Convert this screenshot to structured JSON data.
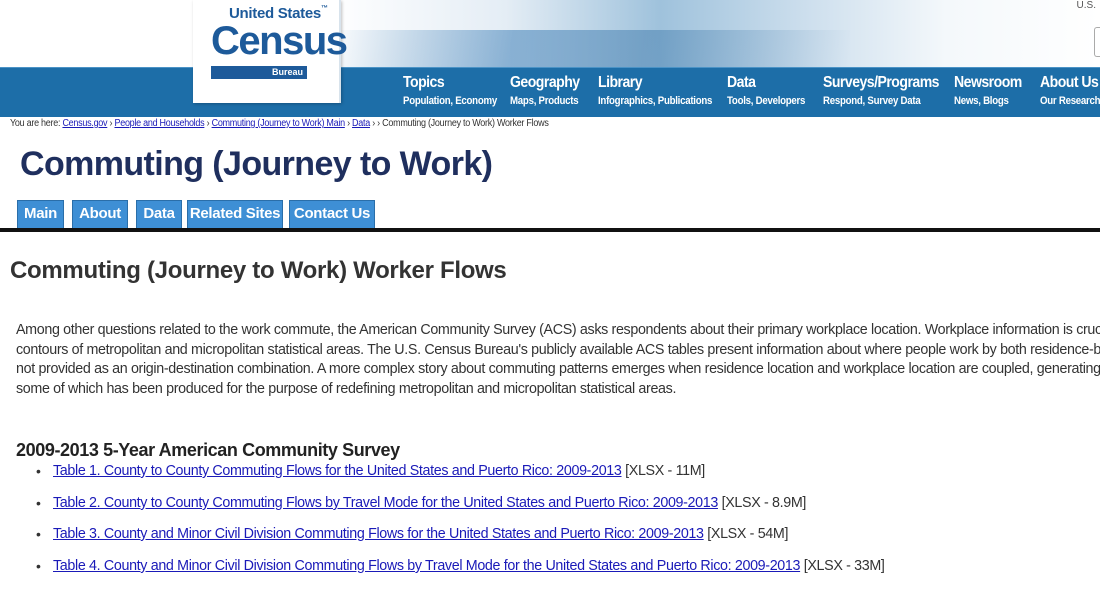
{
  "header": {
    "logo": {
      "line1": "United States",
      "tm": "™",
      "line2": "Census",
      "line3": "Bureau"
    },
    "corner_text": "U.S.",
    "nav": [
      {
        "title": "Topics",
        "sub": "Population, Economy"
      },
      {
        "title": "Geography",
        "sub": "Maps, Products"
      },
      {
        "title": "Library",
        "sub": "Infographics, Publications"
      },
      {
        "title": "Data",
        "sub": "Tools, Developers"
      },
      {
        "title": "Surveys/Programs",
        "sub": "Respond, Survey Data"
      },
      {
        "title": "Newsroom",
        "sub": "News, Blogs"
      },
      {
        "title": "About Us",
        "sub": "Our Research"
      }
    ],
    "colors": {
      "nav_bar": "#1d6ea8",
      "logo_blue": "#1d5a9a"
    }
  },
  "breadcrumb": {
    "prefix": "You are here:",
    "links": [
      "Census.gov",
      "People and Households",
      "Commuting (Journey to Work) Main",
      "Data"
    ],
    "separator": "›",
    "current": "Commuting (Journey to Work) Worker Flows"
  },
  "page": {
    "title": "Commuting (Journey to Work)",
    "tabs": [
      "Main",
      "About",
      "Data",
      "Related Sites",
      "Contact Us"
    ],
    "tab_color": "#3e8fd5"
  },
  "content": {
    "heading": "Commuting (Journey to Work) Worker Flows",
    "intro_lines": [
      "Among other questions related to the work commute, the American Community Survey (ACS) asks respondents about their primary workplace location. Workplace information is crucial for understanding",
      "contours of metropolitan and micropolitan statistical areas. The U.S. Census Bureau's publicly available ACS tables present information about where people work by both residence-based and workplace",
      "not provided as an origin-destination combination. A more complex story about commuting patterns emerges when residence location and workplace location are coupled, generating a \"commuting flow.\"",
      "some of which has been produced for the purpose of redefining metropolitan and micropolitan statistical areas."
    ],
    "survey_heading": "2009-2013 5-Year American Community Survey",
    "bullet": "•",
    "tables": [
      {
        "link": "Table 1. County to County Commuting Flows for the United States and Puerto Rico: 2009-2013",
        "meta": "[XLSX - 11M]"
      },
      {
        "link": "Table 2. County to County Commuting Flows by Travel Mode for the United States and Puerto Rico: 2009-2013",
        "meta": "[XLSX - 8.9M]"
      },
      {
        "link": "Table 3. County and Minor Civil Division Commuting Flows for the United States and Puerto Rico: 2009-2013",
        "meta": "[XLSX - 54M]"
      },
      {
        "link": "Table 4. County and Minor Civil Division Commuting Flows by Travel Mode for the United States and Puerto Rico: 2009-2013",
        "meta": "[XLSX - 33M]"
      }
    ],
    "link_color": "#1a1ab8"
  }
}
